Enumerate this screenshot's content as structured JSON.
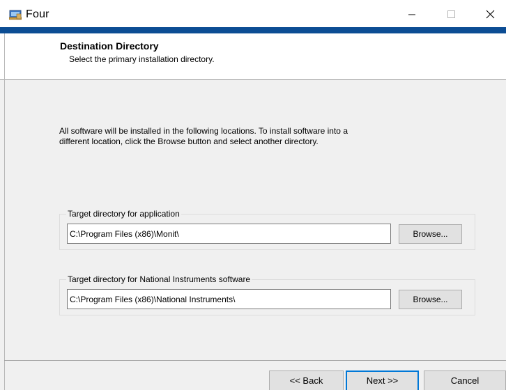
{
  "window": {
    "title": "Four",
    "icon": "installer-app-icon"
  },
  "titlebar_buttons": {
    "minimize_icon": "minimize-icon",
    "maximize_icon": "maximize-icon",
    "close_icon": "close-icon"
  },
  "header": {
    "title": "Destination Directory",
    "subtitle": "Select the primary installation directory."
  },
  "intro": {
    "line1": "All software will be installed in the following locations. To install software into a",
    "line2": "different location, click the Browse button and select another directory."
  },
  "app_dir": {
    "label": "Target directory for application",
    "value": "C:\\Program Files (x86)\\Monit\\",
    "browse_label": "Browse..."
  },
  "ni_dir": {
    "label": "Target directory for National Instruments software",
    "value": "C:\\Program Files (x86)\\National Instruments\\",
    "browse_label": "Browse..."
  },
  "nav": {
    "back_label": "<< Back",
    "next_label": "Next >>",
    "cancel_label": "Cancel"
  },
  "colors": {
    "accent_bar": "#0c4d94",
    "dialog_bg": "#f0f0f0",
    "header_bg": "#ffffff",
    "default_button_border": "#0078d7"
  }
}
